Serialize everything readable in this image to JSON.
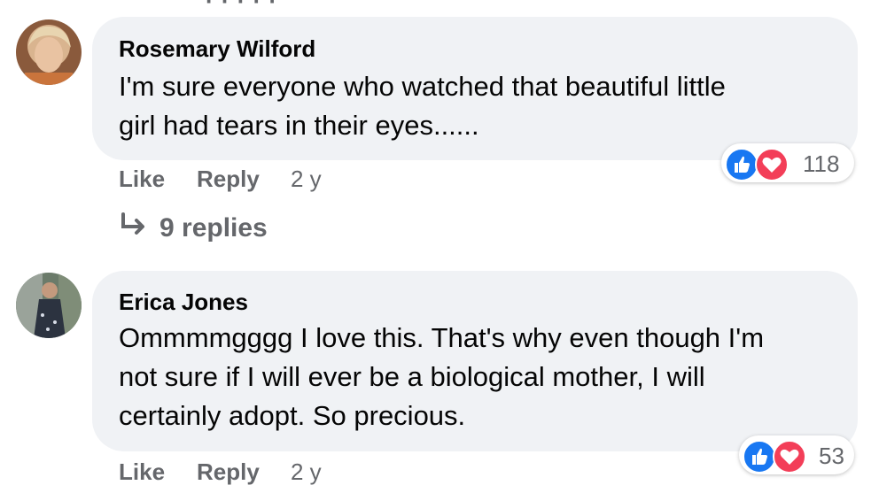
{
  "comments": [
    {
      "author": "Rosemary Wilford",
      "lines": [
        "I'm sure everyone who watched that beautiful little",
        "girl had tears in their eyes......"
      ],
      "like_label": "Like",
      "reply_label": "Reply",
      "time": "2 y",
      "reaction_count": "118",
      "reactions": [
        "like-icon",
        "love-icon"
      ]
    },
    {
      "author": "Erica Jones",
      "lines": [
        "Ommmmgggg I love this. That's why even though I'm",
        "not sure if I will ever be a biological mother, I will",
        "certainly adopt. So precious."
      ],
      "like_label": "Like",
      "reply_label": "Reply",
      "time": "2 y",
      "reaction_count": "53",
      "reactions": [
        "like-icon",
        "love-icon"
      ]
    }
  ],
  "replies_link": "9 replies",
  "colors": {
    "bubble": "#f0f2f5",
    "muted": "#65676b",
    "like_blue": "#1877f2",
    "love_red": "#f33e58"
  }
}
